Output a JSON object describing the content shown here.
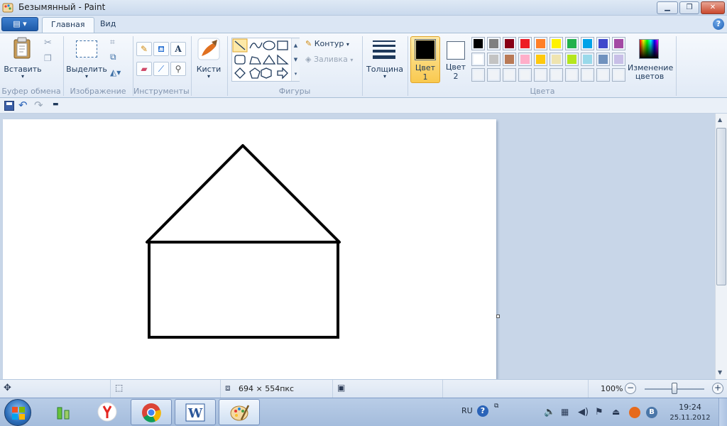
{
  "window": {
    "title": "Безымянный - Paint",
    "min_label": "▁",
    "max_label": "❐",
    "close_label": "✕"
  },
  "tabs": {
    "file_label": "▤ ▾",
    "home": "Главная",
    "view": "Вид",
    "help_label": "?"
  },
  "ribbon": {
    "clipboard": {
      "paste": "Вставить",
      "group": "Буфер обмена"
    },
    "image": {
      "select": "Выделить",
      "group": "Изображение"
    },
    "tools": {
      "group": "Инструменты",
      "text_tool": "A"
    },
    "brushes": {
      "label": "Кисти"
    },
    "shapes": {
      "outline": "Контур",
      "fill": "Заливка",
      "group": "Фигуры"
    },
    "size": {
      "label": "Толщина"
    },
    "color1": {
      "line1": "Цвет",
      "line2": "1",
      "value": "#000000"
    },
    "color2": {
      "line1": "Цвет",
      "line2": "2",
      "value": "#ffffff"
    },
    "colors": {
      "group": "Цвета",
      "edit_line1": "Изменение",
      "edit_line2": "цветов",
      "row1": [
        "#000000",
        "#7f7f7f",
        "#880015",
        "#ed1c24",
        "#ff7f27",
        "#fff200",
        "#22b14c",
        "#00a2e8",
        "#3f48cc",
        "#a349a4"
      ],
      "row2": [
        "#ffffff",
        "#c3c3c3",
        "#b97a57",
        "#ffaec9",
        "#ffc90e",
        "#efe4b0",
        "#b5e61d",
        "#99d9ea",
        "#7092be",
        "#c8bfe7"
      ],
      "row3": [
        "",
        "",
        "",
        "",
        "",
        "",
        "",
        "",
        "",
        ""
      ]
    }
  },
  "status": {
    "image_size": "694 × 554пкс",
    "zoom": "100%",
    "zoom_level": 1.0
  },
  "taskbar": {
    "lang": "RU",
    "time": "19:24",
    "date": "25.11.2012",
    "help_label": "?"
  }
}
